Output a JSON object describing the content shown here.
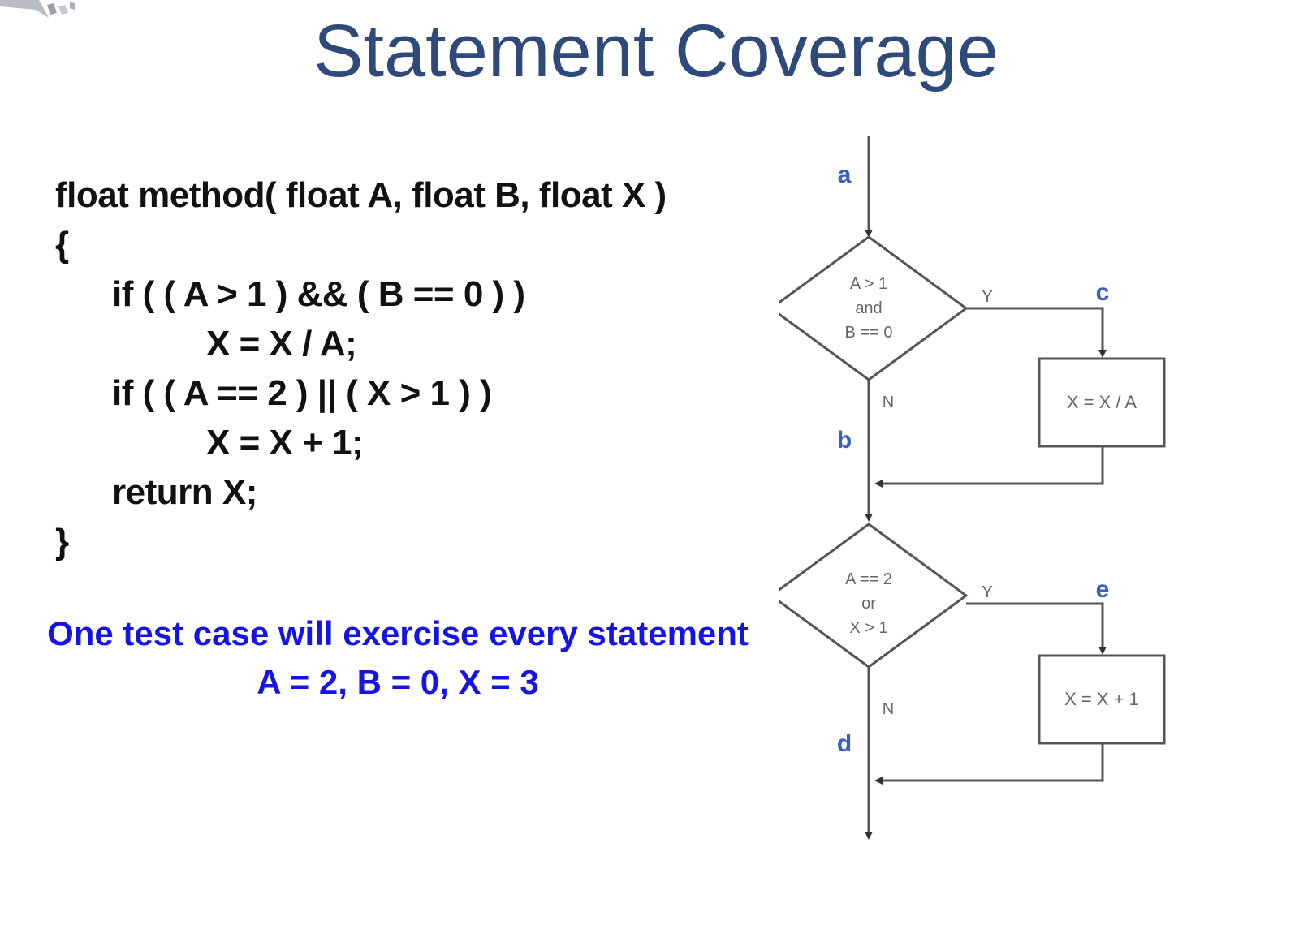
{
  "title": "Statement Coverage",
  "code": {
    "line1": "float method( float A, float B, float X )",
    "line2": "{",
    "line3": "if ( ( A > 1 ) && ( B == 0 ) )",
    "line4": "X = X / A;",
    "line5": "if ( ( A == 2 ) || ( X > 1 ) )",
    "line6": "X = X + 1;",
    "line7": "return X;",
    "line8": "}"
  },
  "note": {
    "line1": "One test case will exercise every statement",
    "line2": "A = 2, B = 0, X = 3"
  },
  "flowchart": {
    "path_labels": {
      "a": "a",
      "b": "b",
      "c": "c",
      "d": "d",
      "e": "e"
    },
    "decision1": {
      "line1": "A > 1",
      "line2": "and",
      "line3": "B == 0",
      "yes": "Y",
      "no": "N"
    },
    "process1": "X = X / A",
    "decision2": {
      "line1": "A == 2",
      "line2": "or",
      "line3": "X > 1",
      "yes": "Y",
      "no": "N"
    },
    "process2": "X = X + 1"
  },
  "colors": {
    "title": "#2e4a7a",
    "code": "#111111",
    "note": "#1414e6",
    "path_label": "#3a5ec4",
    "flow_line": "#555555"
  }
}
